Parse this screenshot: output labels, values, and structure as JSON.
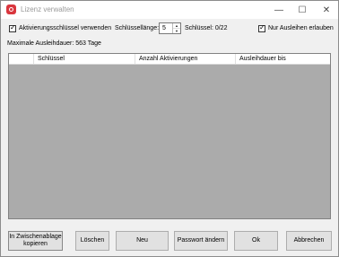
{
  "window": {
    "title": "Lizenz verwalten",
    "minimize": "—",
    "maximize": "☐",
    "close": "✕"
  },
  "options": {
    "use_activation_keys_label": "Aktivierungsschlüssel verwenden",
    "use_activation_keys_checked": true,
    "key_length_label": "Schlüssellänge:",
    "key_length_value": "5",
    "key_count_label": "Schlüssel: 0/22",
    "only_lending_label": "Nur Ausleihen erlauben",
    "only_lending_checked": true
  },
  "max_lend_label": "Maximale Ausleihdauer: 563 Tage",
  "table": {
    "columns": [
      "Schlüssel",
      "Anzahl Aktivierungen",
      "Ausleihdauer bis"
    ],
    "rows": []
  },
  "buttons": {
    "copy": "In Zwischenablage kopieren",
    "delete": "Löschen",
    "new": "Neu",
    "change_password": "Passwort ändern",
    "ok": "Ok",
    "cancel": "Abbrechen"
  }
}
